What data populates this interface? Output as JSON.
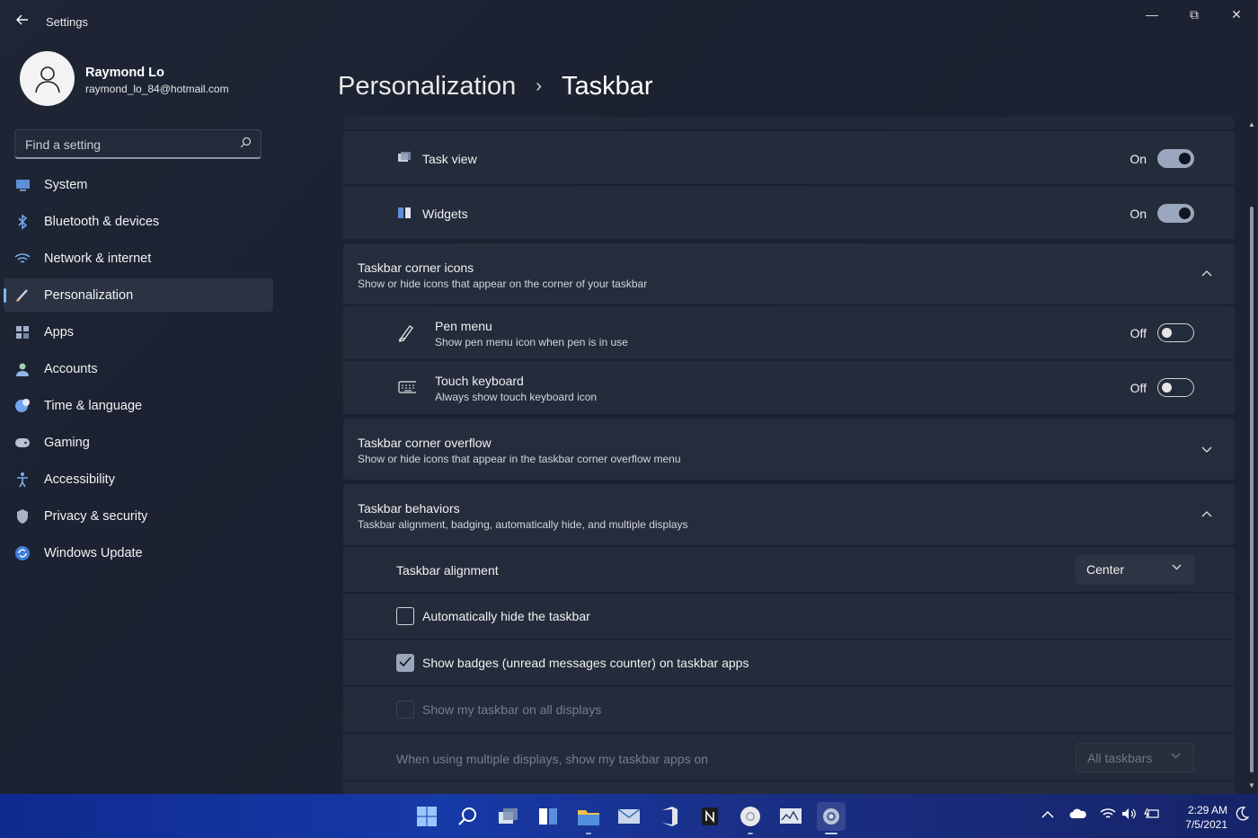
{
  "window": {
    "title": "Settings",
    "controls": {
      "minimize": "—",
      "maximize": "⧉",
      "close": "✕"
    }
  },
  "user": {
    "name": "Raymond Lo",
    "email": "raymond_lo_84@hotmail.com"
  },
  "search": {
    "placeholder": "Find a setting"
  },
  "nav": [
    {
      "label": "System",
      "icon": "monitor-icon"
    },
    {
      "label": "Bluetooth & devices",
      "icon": "bluetooth-icon"
    },
    {
      "label": "Network & internet",
      "icon": "wifi-icon"
    },
    {
      "label": "Personalization",
      "icon": "brush-icon",
      "active": true
    },
    {
      "label": "Apps",
      "icon": "apps-icon"
    },
    {
      "label": "Accounts",
      "icon": "person-icon"
    },
    {
      "label": "Time & language",
      "icon": "globe-clock-icon"
    },
    {
      "label": "Gaming",
      "icon": "gamepad-icon"
    },
    {
      "label": "Accessibility",
      "icon": "accessibility-icon"
    },
    {
      "label": "Privacy & security",
      "icon": "shield-icon"
    },
    {
      "label": "Windows Update",
      "icon": "update-icon"
    }
  ],
  "breadcrumb": {
    "parent": "Personalization",
    "separator": "›",
    "current": "Taskbar"
  },
  "taskbar_items": {
    "task_view": {
      "label": "Task view",
      "state": "On",
      "on": true
    },
    "widgets": {
      "label": "Widgets",
      "state": "On",
      "on": true
    }
  },
  "corner_icons": {
    "title": "Taskbar corner icons",
    "subtitle": "Show or hide icons that appear on the corner of your taskbar",
    "expanded": true,
    "pen_menu": {
      "label": "Pen menu",
      "sub": "Show pen menu icon when pen is in use",
      "state": "Off",
      "on": false
    },
    "touch_keyboard": {
      "label": "Touch keyboard",
      "sub": "Always show touch keyboard icon",
      "state": "Off",
      "on": false
    }
  },
  "corner_overflow": {
    "title": "Taskbar corner overflow",
    "subtitle": "Show or hide icons that appear in the taskbar corner overflow menu",
    "expanded": false
  },
  "behaviors": {
    "title": "Taskbar behaviors",
    "subtitle": "Taskbar alignment, badging, automatically hide, and multiple displays",
    "expanded": true,
    "alignment": {
      "label": "Taskbar alignment",
      "value": "Center"
    },
    "auto_hide": {
      "label": "Automatically hide the taskbar",
      "checked": false
    },
    "badges": {
      "label": "Show badges (unread messages counter) on taskbar apps",
      "checked": true
    },
    "all_displays": {
      "label": "Show my taskbar on all displays",
      "checked": false,
      "disabled": true
    },
    "multi_display": {
      "label": "When using multiple displays, show my taskbar apps on",
      "value": "All taskbars",
      "disabled": true
    }
  },
  "system_taskbar": {
    "apps": [
      "start-icon",
      "search-icon",
      "task-view-icon",
      "widgets-icon",
      "file-explorer-icon",
      "mail-icon",
      "office-icon",
      "notion-icon",
      "chrome-icon",
      "monitor-app-icon",
      "settings-icon"
    ],
    "time": "2:29 AM",
    "date": "7/5/2021"
  },
  "colors": {
    "accent": "#9aa6bb",
    "background": "#1c2230",
    "card": "#252c3b",
    "taskbar": "#163aa8"
  }
}
